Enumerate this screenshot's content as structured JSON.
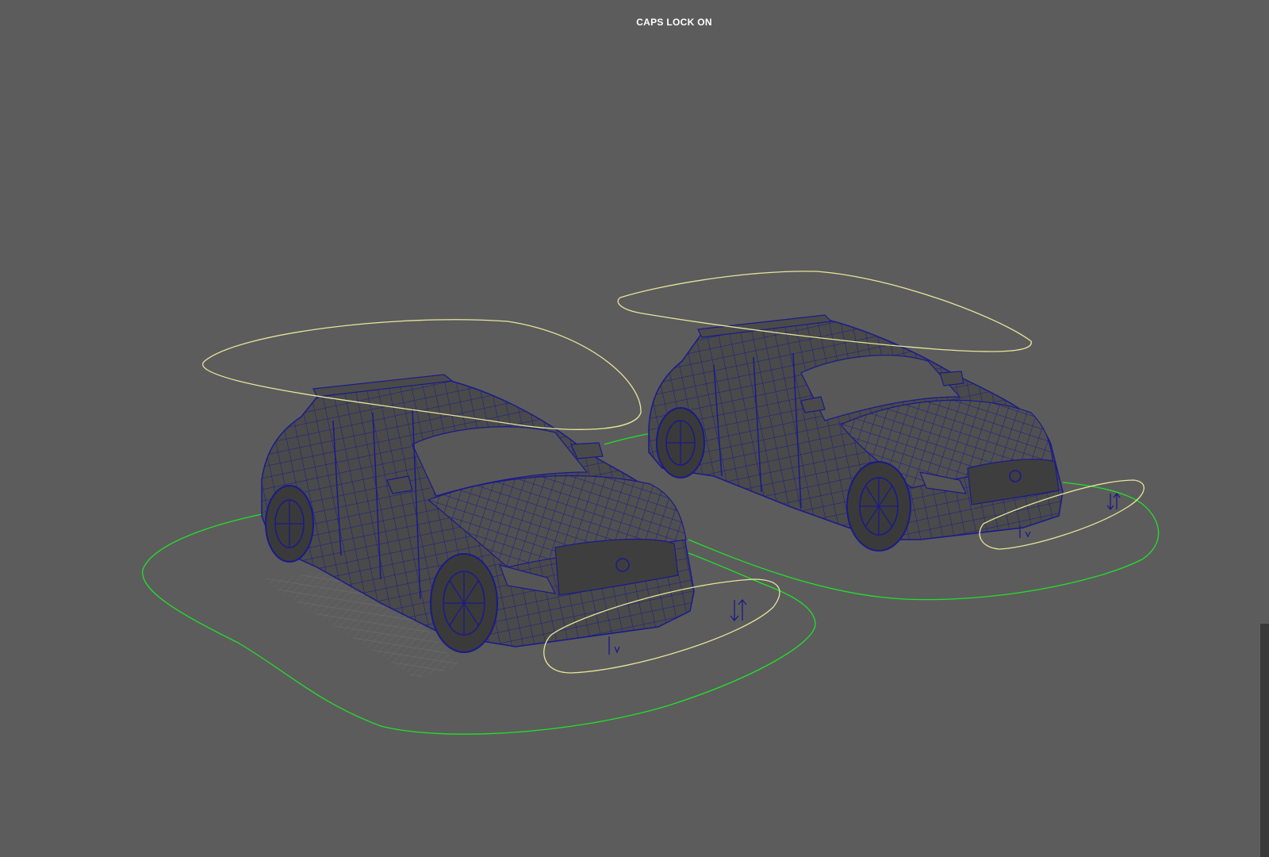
{
  "viewport": {
    "hud_message": "CAPS LOCK ON",
    "background_color": "#5c5c5c"
  },
  "colors": {
    "wireframe": "#1a1a8c",
    "body_fill": "#4a4a4a",
    "main_control": "#22e02a",
    "sub_control": "#e6e69c",
    "ground_grid": "#6e6e6e"
  },
  "scene": {
    "objects": [
      {
        "name": "car-rig-left",
        "controls": [
          "main-control-ring",
          "roof-control-ring",
          "front-control-ring"
        ]
      },
      {
        "name": "car-rig-right",
        "controls": [
          "main-control-ring",
          "roof-control-ring",
          "front-control-ring"
        ]
      }
    ]
  }
}
